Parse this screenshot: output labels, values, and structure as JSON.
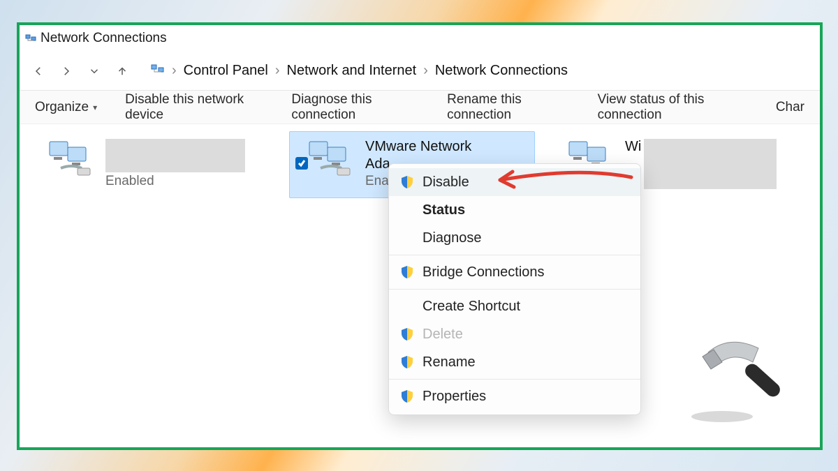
{
  "window": {
    "title": "Network Connections"
  },
  "breadcrumb": {
    "root_sep": "›",
    "items": [
      "Control Panel",
      "Network and Internet",
      "Network Connections"
    ]
  },
  "toolbar": {
    "organize": "Organize",
    "disable": "Disable this network device",
    "diagnose": "Diagnose this connection",
    "rename": "Rename this connection",
    "view_status": "View status of this connection",
    "change_cutoff": "Char"
  },
  "adapters": [
    {
      "name_redacted": true,
      "status": "Enabled",
      "selected": false,
      "name_prefix": ""
    },
    {
      "name": "VMware Network",
      "name_line2_prefix": "Ada",
      "status_prefix": "Ena",
      "selected": true
    },
    {
      "name_prefix": "Wi",
      "name_redacted": true
    }
  ],
  "context_menu": {
    "disable": "Disable",
    "status": "Status",
    "diagnose": "Diagnose",
    "bridge": "Bridge Connections",
    "create_shortcut": "Create Shortcut",
    "delete": "Delete",
    "rename": "Rename",
    "properties": "Properties"
  }
}
